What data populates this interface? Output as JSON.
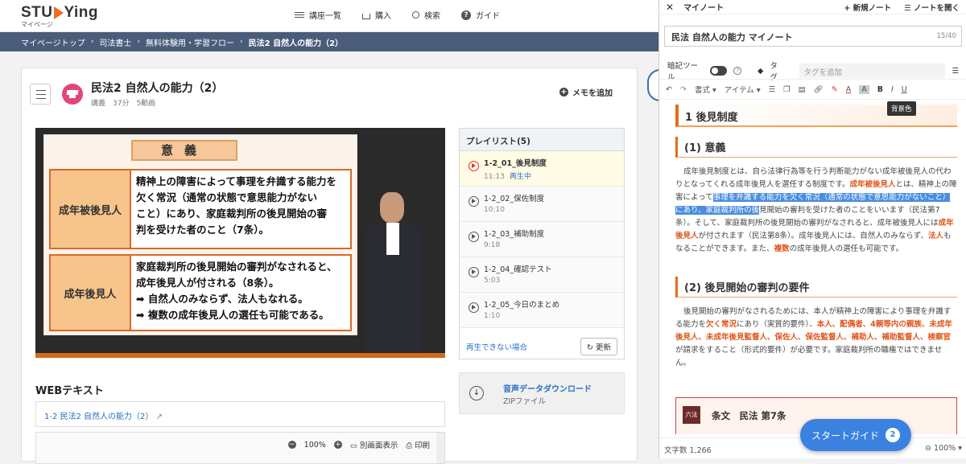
{
  "header": {
    "logo": "STUDYing",
    "logo_sub": "マイページ",
    "nav": [
      {
        "label": "講座一覧",
        "icon": "list-icon"
      },
      {
        "label": "購入",
        "icon": "cart-icon"
      },
      {
        "label": "検索",
        "icon": "search-icon"
      },
      {
        "label": "ガイド",
        "icon": "question-icon"
      }
    ]
  },
  "breadcrumb": [
    "マイページトップ",
    "司法書士",
    "無料体験用・学習フロー",
    "民法2 自然人の能力（2）"
  ],
  "lecture": {
    "title": "民法2 自然人の能力（2）",
    "meta": "講義　37分　5動画",
    "memo_label": "メモを追加"
  },
  "slide": {
    "title": "意義",
    "rows": [
      {
        "label": "成年被後見人",
        "lines": [
          "精神上の障害によって事理を弁識する能力を",
          "欠く常況（通常の状態で意思能力がない",
          "こと）にあり、家庭裁判所の後見開始の審",
          "判を受けた者のこと（7条）。"
        ]
      },
      {
        "label": "成年後見人",
        "lines": [
          "家庭裁判所の後見開始の審判がなされると、",
          "成年後見人が付される（8条）。",
          "➡ 自然人のみならず、法人もなれる。",
          "➡ 複数の成年後見人の選任も可能である。"
        ]
      }
    ]
  },
  "playlist": {
    "header": "プレイリスト(5)",
    "items": [
      {
        "name": "1-2_01_後見制度",
        "duration": "11:13",
        "status": "再生中"
      },
      {
        "name": "1-2_02_保佐制度",
        "duration": "10:10",
        "status": ""
      },
      {
        "name": "1-2_03_補助制度",
        "duration": "9:18",
        "status": ""
      },
      {
        "name": "1-2_04_確認テスト",
        "duration": "5:03",
        "status": ""
      },
      {
        "name": "1-2_05_今日のまとめ",
        "duration": "1:10",
        "status": ""
      }
    ],
    "cannot_play": "再生できない場合",
    "refresh": "更新"
  },
  "download": {
    "title": "音声データダウンロード",
    "sub": "ZIPファイル"
  },
  "webtext": {
    "heading": "WEBテキスト",
    "link": "1-2 民法2 自然人の能力（2）",
    "zoom": "100%",
    "separate": "別画面表示",
    "print": "印刷"
  },
  "note": {
    "panel_title": "マイノート",
    "new_note": "新規ノート",
    "open_note": "ノートを開く",
    "name": "民法 自然人の能力 マイノート",
    "name_count": "15/40",
    "anki_label": "暗記ツール",
    "tag_label": "タグ",
    "tag_placeholder": "タグを追加",
    "toolbar": {
      "format": "書式",
      "item": "アイテム"
    },
    "tooltip": "背景色",
    "h1": "1 後見制度",
    "h2a": "(1) 意義",
    "p1": [
      "成年後見制度とは、自ら法律行為等を行う判断能力がない成年被後見人の代わりとなってくれる成年後見人を選任する制度です。",
      "成年被後見人",
      "とは、精神上の障害によって",
      "事理を弁識する能力を欠く常況（通常の状態で意思能力がないこと）にあり、家庭裁判所の後",
      "見開始の審判を受けた者のことをいいます（民法第7条）。そして、家庭裁判所の後見開始の審判がなされると、成年被後見人には",
      "成年後見人",
      "が付されます（民法第8条）。成年後見人には、自然人のみならず、",
      "法人",
      "もなることができます。また、",
      "複数",
      "の成年後見人の選任も可能です。"
    ],
    "h2b": "(2) 後見開始の審判の要件",
    "p2": [
      "後見開始の審判がなされるためには、本人が精神上の障害により事理を弁識する能力を",
      "欠く常況",
      "にあり（実質的要件）、",
      "本人、配偶者、4親等内の親族、未成年後見人、未成年後見監督人、保佐人、保佐監督人、補助人、補助監督人、検察官",
      "が請求をすること（形式的要件）が必要です。家庭裁判所の職権ではできません。"
    ],
    "article": "条文　民法 第7条",
    "article_icon": "六法",
    "char_count": "文字数 1,266",
    "zoom": "100%"
  },
  "start_guide": {
    "label": "スタートガイド",
    "count": "2"
  }
}
